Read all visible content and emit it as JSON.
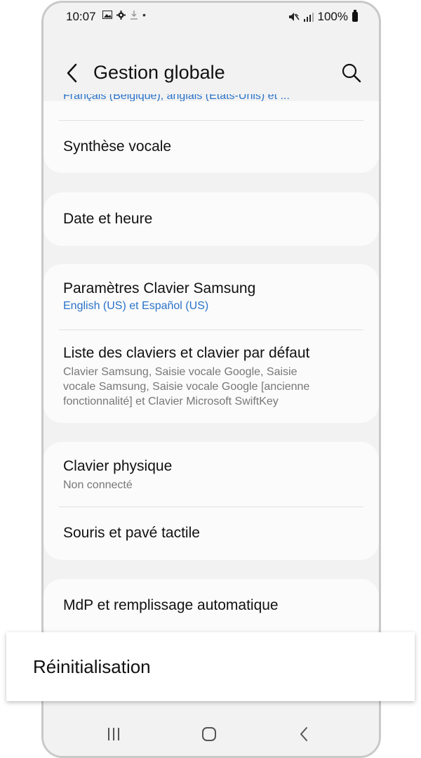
{
  "status_bar": {
    "time": "10:07",
    "battery": "100%",
    "icons": [
      "image-icon",
      "gear-icon",
      "download-icon",
      "dot-icon",
      "mute-icon",
      "signal-icon",
      "battery-icon"
    ]
  },
  "header": {
    "title": "Gestion globale",
    "back_icon": "back-arrow-icon",
    "search_icon": "search-icon"
  },
  "sections": {
    "cut_language_subtitle": "Français (Belgique), anglais (États-Unis) et ...",
    "synthese": {
      "label": "Synthèse vocale"
    },
    "date": {
      "label": "Date et heure"
    },
    "clavier_samsung": {
      "label": "Paramètres Clavier Samsung",
      "subtitle": "English (US) et Español (US)"
    },
    "liste_claviers": {
      "label": "Liste des claviers et clavier par défaut",
      "subtitle_line1": "Clavier Samsung, Saisie vocale Google, Saisie",
      "subtitle_line2": "vocale Samsung, Saisie vocale Google [ancienne",
      "subtitle_line3": "fonctionnalité] et Clavier Microsoft SwiftKey"
    },
    "clavier_physique": {
      "label": "Clavier physique",
      "subtitle": "Non connecté"
    },
    "souris": {
      "label": "Souris et pavé tactile"
    },
    "mdp": {
      "label": "MdP et remplissage automatique"
    }
  },
  "highlight": {
    "label": "Réinitialisation"
  },
  "navbar": {
    "icons": [
      "recent-apps-icon",
      "home-icon",
      "back-icon"
    ]
  }
}
